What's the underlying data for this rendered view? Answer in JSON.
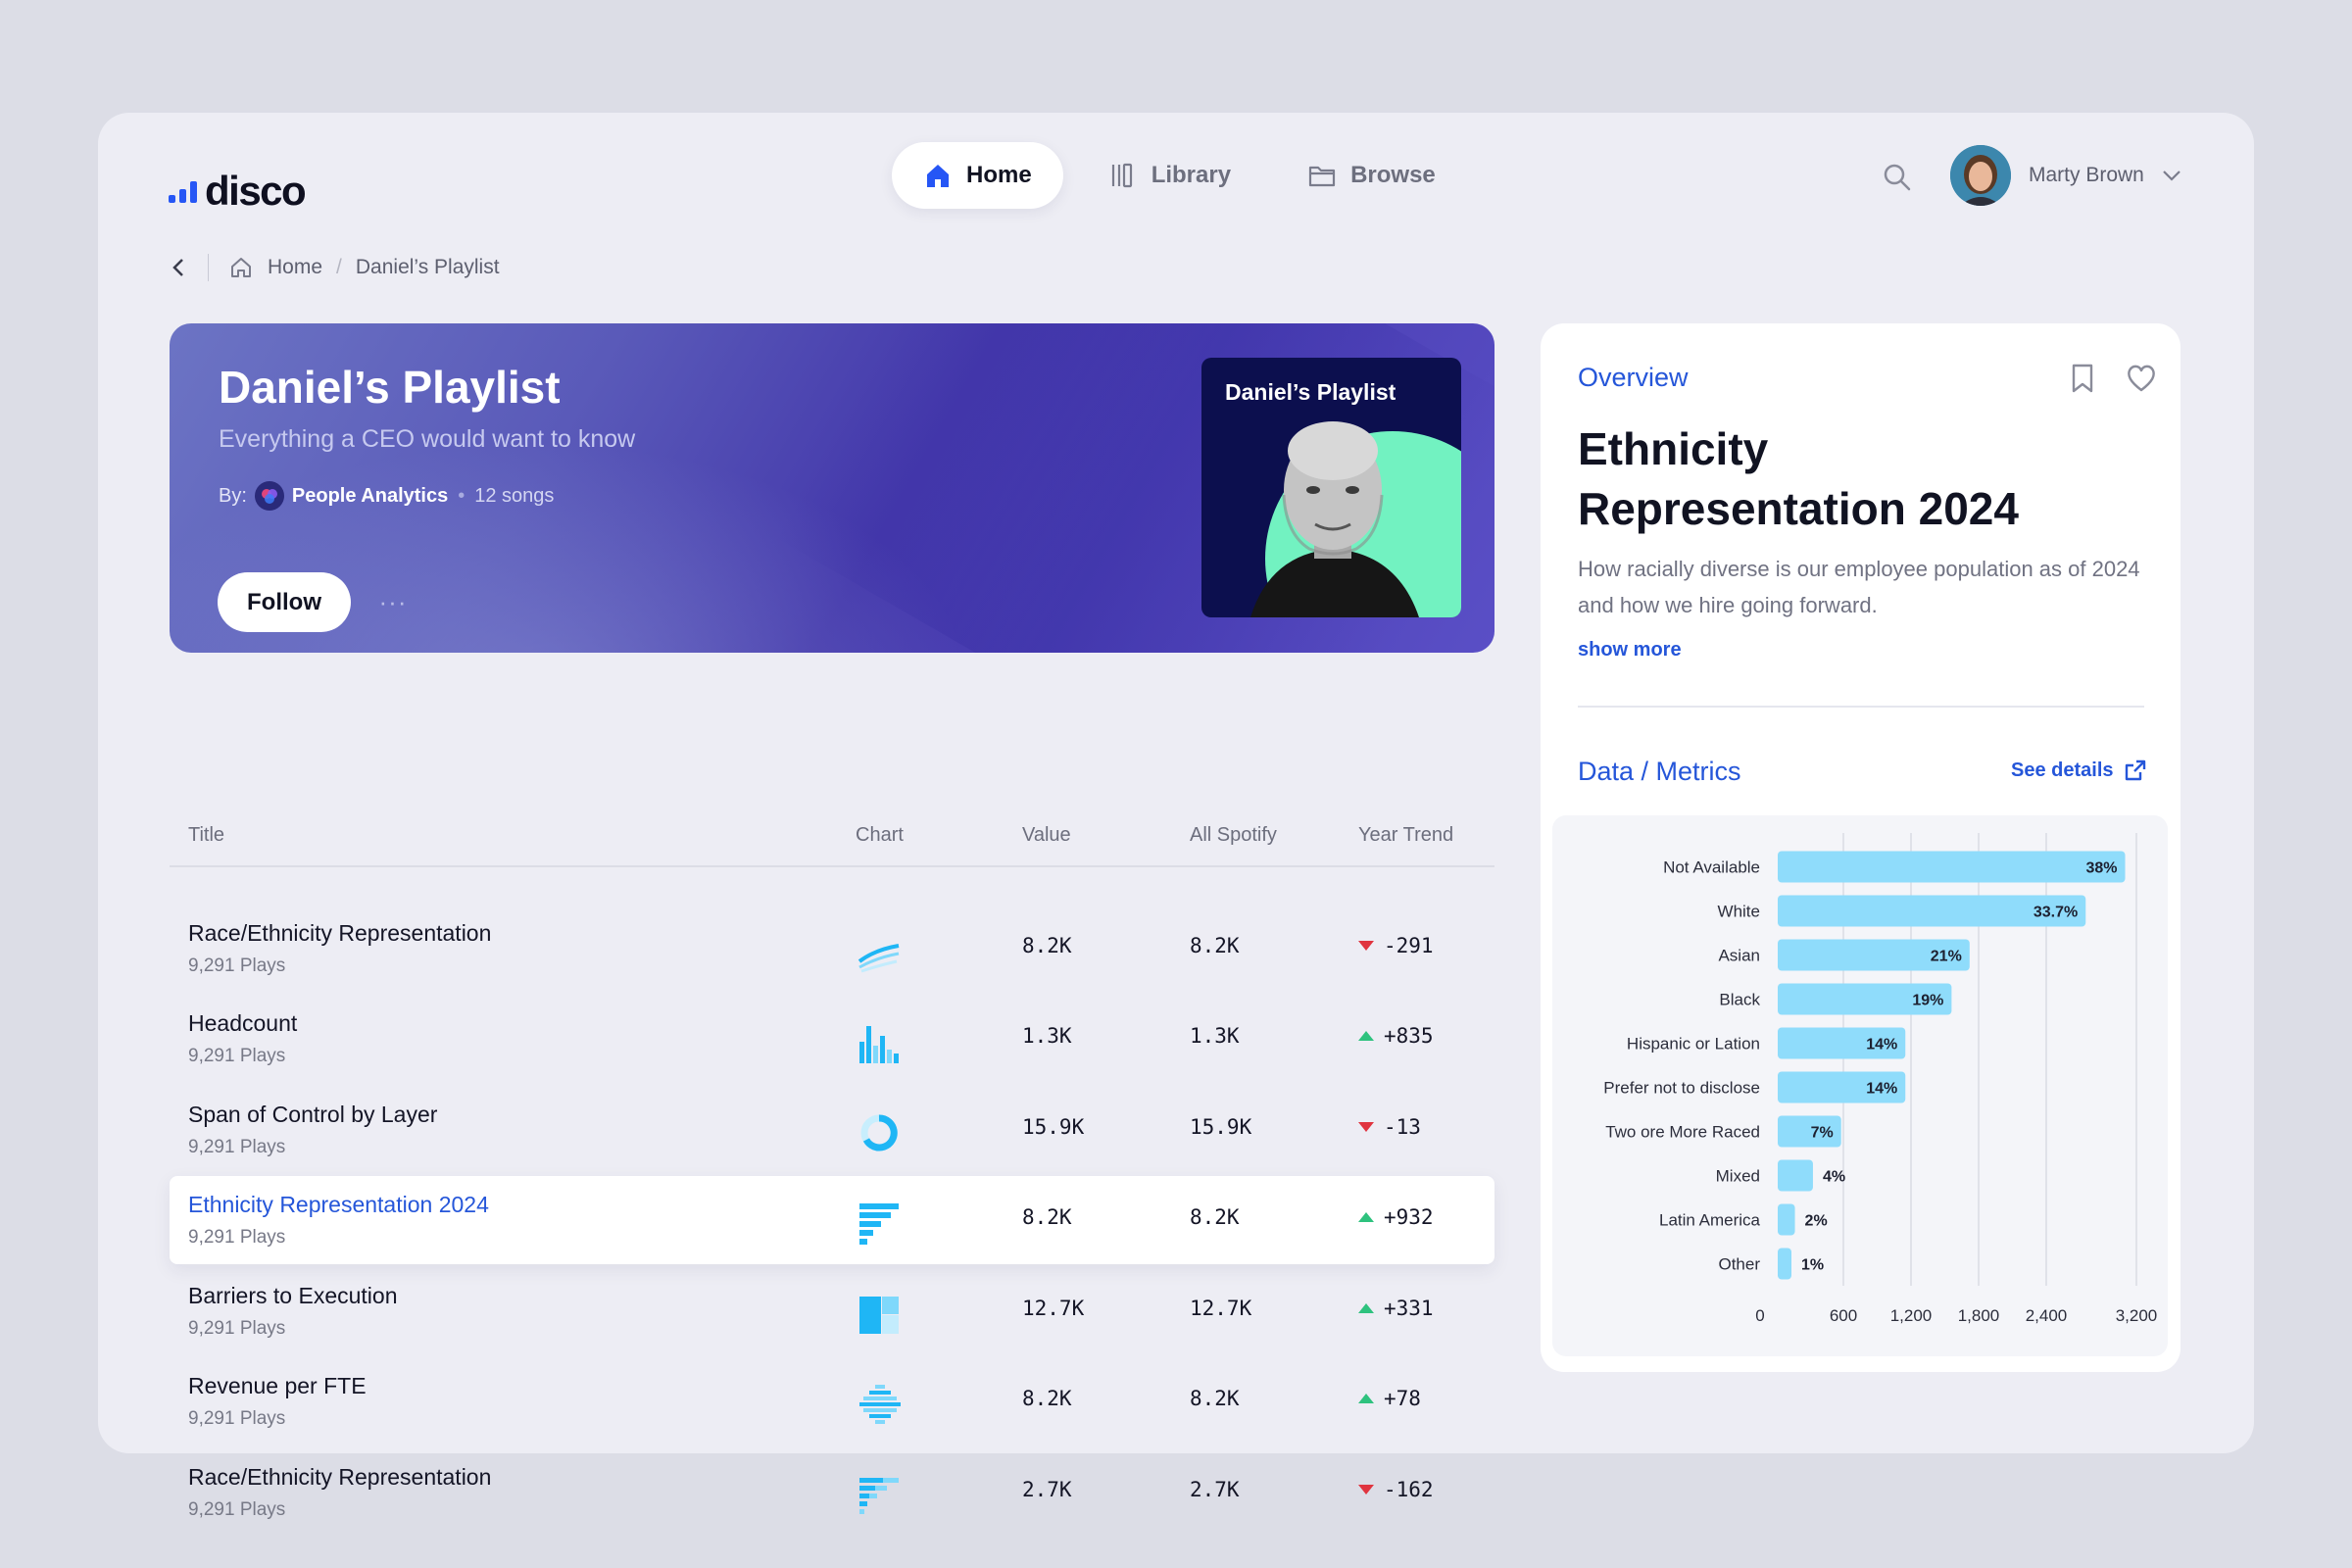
{
  "app": {
    "logo_text": "disco",
    "brand_color": "#2656f5"
  },
  "nav": {
    "items": [
      {
        "label": "Home",
        "icon": "home-icon",
        "active": true
      },
      {
        "label": "Library",
        "icon": "library-icon",
        "active": false
      },
      {
        "label": "Browse",
        "icon": "folder-icon",
        "active": false
      }
    ]
  },
  "user": {
    "name": "Marty Brown",
    "icon": "chevron-down-icon"
  },
  "breadcrumb": {
    "items": [
      "Home",
      "Daniel’s Playlist"
    ]
  },
  "playlist": {
    "title": "Daniel’s Playlist",
    "subtitle": "Everything a CEO would want to know",
    "by_label": "By:",
    "author": "People Analytics",
    "songs": "12 songs",
    "follow_label": "Follow",
    "more_label": "···",
    "cover_title": "Daniel’s Playlist"
  },
  "table": {
    "headers": {
      "title": "Title",
      "chart": "Chart",
      "value": "Value",
      "all": "All Spotify",
      "trend": "Year Trend"
    },
    "rows": [
      {
        "title": "Race/Ethnicity Representation",
        "plays": "9,291 Plays",
        "chart_icon": "line-chart-icon",
        "value": "8.2K",
        "all": "8.2K",
        "trend": "-291",
        "direction": "down",
        "selected": false
      },
      {
        "title": "Headcount",
        "plays": "9,291 Plays",
        "chart_icon": "column-chart-icon",
        "value": "1.3K",
        "all": "1.3K",
        "trend": "+835",
        "direction": "up",
        "selected": false
      },
      {
        "title": "Span of Control by Layer",
        "plays": "9,291 Plays",
        "chart_icon": "donut-chart-icon",
        "value": "15.9K",
        "all": "15.9K",
        "trend": "-13",
        "direction": "down",
        "selected": false
      },
      {
        "title": "Ethnicity Representation 2024",
        "plays": "9,291 Plays",
        "chart_icon": "bar-chart-icon",
        "value": "8.2K",
        "all": "8.2K",
        "trend": "+932",
        "direction": "up",
        "selected": true
      },
      {
        "title": "Barriers to Execution",
        "plays": "9,291 Plays",
        "chart_icon": "treemap-icon",
        "value": "12.7K",
        "all": "12.7K",
        "trend": "+331",
        "direction": "up",
        "selected": false
      },
      {
        "title": "Revenue per FTE",
        "plays": "9,291 Plays",
        "chart_icon": "butterfly-chart-icon",
        "value": "8.2K",
        "all": "8.2K",
        "trend": "+78",
        "direction": "up",
        "selected": false
      },
      {
        "title": "Race/Ethnicity Representation",
        "plays": "9,291 Plays",
        "chart_icon": "stacked-bar-chart-icon",
        "value": "2.7K",
        "all": "2.7K",
        "trend": "-162",
        "direction": "down",
        "selected": false
      }
    ]
  },
  "overview": {
    "label": "Overview",
    "title": "Ethnicity Representation 2024",
    "description": "How racially diverse is our employee population as of 2024 and how we hire going forward.",
    "show_more": "show more",
    "metrics_label": "Data / Metrics",
    "see_details": "See details"
  },
  "chart_data": {
    "type": "bar",
    "orientation": "horizontal",
    "categories": [
      "Not Available",
      "White",
      "Asian",
      "Black",
      "Hispanic or Lation",
      "Prefer not to disclose",
      "Two ore More Raced",
      "Mixed",
      "Latin America",
      "Other"
    ],
    "values": [
      3100,
      2750,
      1720,
      1560,
      1150,
      1150,
      580,
      330,
      170,
      85
    ],
    "labels": [
      "38%",
      "33.7%",
      "21%",
      "19%",
      "14%",
      "14%",
      "7%",
      "4%",
      "2%",
      "1%"
    ],
    "x_ticks": [
      "0",
      "600",
      "1,200",
      "1,800",
      "2,400",
      "3,200"
    ],
    "xlim": [
      0,
      3200
    ],
    "grid": true,
    "bar_color": "#8fdcfb"
  }
}
